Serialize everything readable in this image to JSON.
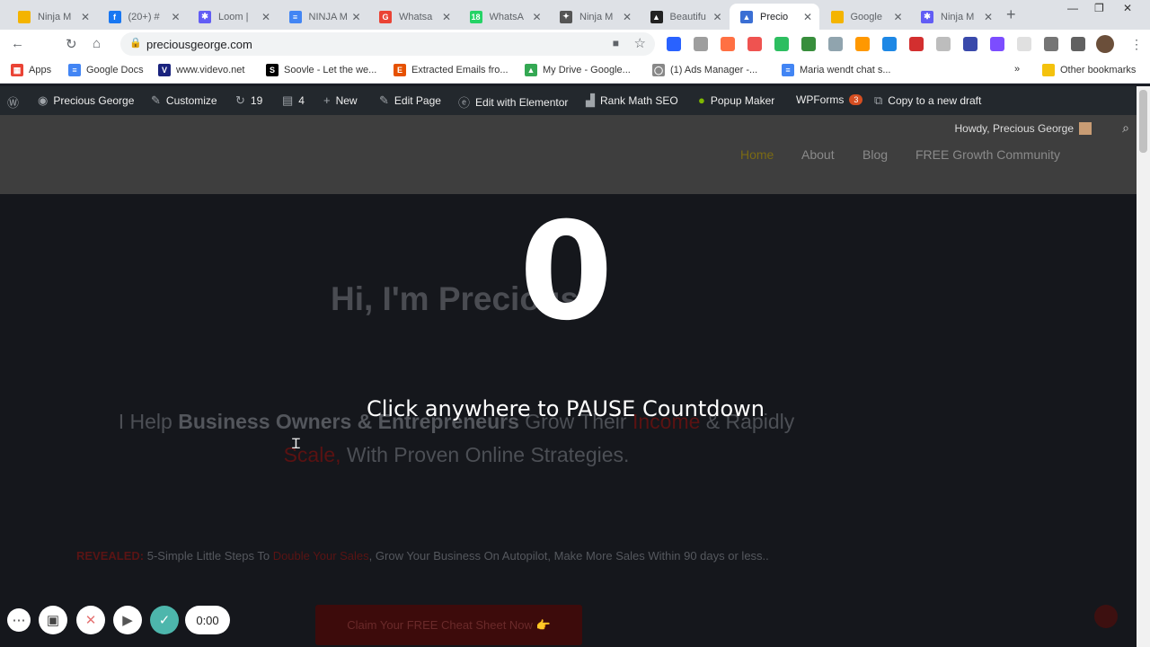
{
  "tabs": [
    {
      "title": "Ninja M",
      "color": "#f4b400",
      "glyph": ""
    },
    {
      "title": "(20+) #",
      "color": "#1877f2",
      "glyph": "f"
    },
    {
      "title": "Loom |",
      "color": "#625df5",
      "glyph": "✱"
    },
    {
      "title": "NINJA M",
      "color": "#4285f4",
      "glyph": "≡"
    },
    {
      "title": "Whatsa",
      "color": "#ea4335",
      "glyph": "G"
    },
    {
      "title": "WhatsA",
      "color": "#25d366",
      "glyph": "18"
    },
    {
      "title": "Ninja M",
      "color": "#555555",
      "glyph": "✦"
    },
    {
      "title": "Beautifu",
      "color": "#222222",
      "glyph": "▲"
    },
    {
      "title": "Precio",
      "color": "#3b6fd4",
      "glyph": "▲",
      "active": true
    },
    {
      "title": "Google",
      "color": "#f4b400",
      "glyph": ""
    },
    {
      "title": "Ninja M",
      "color": "#625df5",
      "glyph": "✱"
    }
  ],
  "address": {
    "url": "preciousgeorge.com"
  },
  "bookmarks": [
    {
      "label": "Apps",
      "color": "#ea4335",
      "glyph": "▦"
    },
    {
      "label": "Google Docs",
      "color": "#4285f4",
      "glyph": "≡"
    },
    {
      "label": "www.videvo.net",
      "color": "#1a237e",
      "glyph": "V"
    },
    {
      "label": "Soovle - Let the we...",
      "color": "#000000",
      "glyph": "S"
    },
    {
      "label": "Extracted Emails fro...",
      "color": "#e65100",
      "glyph": "E"
    },
    {
      "label": "My Drive - Google...",
      "color": "#34a853",
      "glyph": "▲"
    },
    {
      "label": "(1) Ads Manager -...",
      "color": "#888888",
      "glyph": "◯"
    },
    {
      "label": "Maria wendt chat s...",
      "color": "#4285f4",
      "glyph": "≡"
    },
    {
      "label": "Other bookmarks",
      "color": "#f4c20d",
      "glyph": ""
    }
  ],
  "bookmarks_overflow": "»",
  "wpbar": {
    "site": "Precious George",
    "customize": "Customize",
    "updates": "19",
    "comments": "4",
    "new": "New",
    "edit_page": "Edit Page",
    "elementor": "Edit with Elementor",
    "rankmath": "Rank Math SEO",
    "popup": "Popup Maker",
    "wpforms": "WPForms",
    "wpforms_badge": "3",
    "copy_draft": "Copy to a new draft"
  },
  "header": {
    "howdy": "Howdy, Precious George",
    "menu": [
      "Home",
      "About",
      "Blog",
      "FREE Growth Community"
    ]
  },
  "hero": {
    "greeting": "Hi, I'm Precious.",
    "countdown": "0",
    "pause_text": "Click anywhere to PAUSE Countdown",
    "help_1": "I Help ",
    "help_2": "Business Owners & Entrepreneurs",
    "help_3": " Grow Their ",
    "help_4": "Income",
    "help_5": " & Rapidly ",
    "help_6": "Scale,",
    "help_7": " With Proven Online Strategies.",
    "revealed_label": "REVEALED:",
    "revealed_1": " 5-Simple Little Steps To ",
    "revealed_2": "Double Your Sales",
    "revealed_3": ", Grow Your Business On Autopilot, Make More Sales Within 90 days or less..",
    "cta": "Claim Your FREE Cheat Sheet Now 👉"
  },
  "recorder": {
    "timer": "0:00"
  }
}
